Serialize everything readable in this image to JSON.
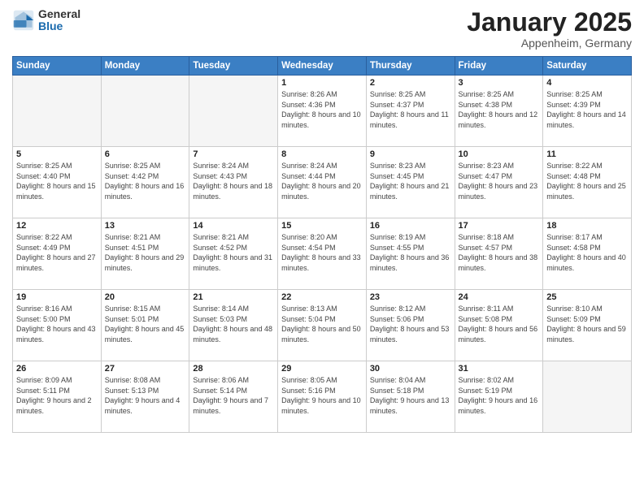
{
  "header": {
    "logo_general": "General",
    "logo_blue": "Blue",
    "month_title": "January 2025",
    "location": "Appenheim, Germany"
  },
  "days_of_week": [
    "Sunday",
    "Monday",
    "Tuesday",
    "Wednesday",
    "Thursday",
    "Friday",
    "Saturday"
  ],
  "weeks": [
    [
      {
        "day": "",
        "empty": true
      },
      {
        "day": "",
        "empty": true
      },
      {
        "day": "",
        "empty": true
      },
      {
        "day": "1",
        "sunrise": "8:26 AM",
        "sunset": "4:36 PM",
        "daylight": "8 hours and 10 minutes."
      },
      {
        "day": "2",
        "sunrise": "8:25 AM",
        "sunset": "4:37 PM",
        "daylight": "8 hours and 11 minutes."
      },
      {
        "day": "3",
        "sunrise": "8:25 AM",
        "sunset": "4:38 PM",
        "daylight": "8 hours and 12 minutes."
      },
      {
        "day": "4",
        "sunrise": "8:25 AM",
        "sunset": "4:39 PM",
        "daylight": "8 hours and 14 minutes."
      }
    ],
    [
      {
        "day": "5",
        "sunrise": "8:25 AM",
        "sunset": "4:40 PM",
        "daylight": "8 hours and 15 minutes."
      },
      {
        "day": "6",
        "sunrise": "8:25 AM",
        "sunset": "4:42 PM",
        "daylight": "8 hours and 16 minutes."
      },
      {
        "day": "7",
        "sunrise": "8:24 AM",
        "sunset": "4:43 PM",
        "daylight": "8 hours and 18 minutes."
      },
      {
        "day": "8",
        "sunrise": "8:24 AM",
        "sunset": "4:44 PM",
        "daylight": "8 hours and 20 minutes."
      },
      {
        "day": "9",
        "sunrise": "8:23 AM",
        "sunset": "4:45 PM",
        "daylight": "8 hours and 21 minutes."
      },
      {
        "day": "10",
        "sunrise": "8:23 AM",
        "sunset": "4:47 PM",
        "daylight": "8 hours and 23 minutes."
      },
      {
        "day": "11",
        "sunrise": "8:22 AM",
        "sunset": "4:48 PM",
        "daylight": "8 hours and 25 minutes."
      }
    ],
    [
      {
        "day": "12",
        "sunrise": "8:22 AM",
        "sunset": "4:49 PM",
        "daylight": "8 hours and 27 minutes."
      },
      {
        "day": "13",
        "sunrise": "8:21 AM",
        "sunset": "4:51 PM",
        "daylight": "8 hours and 29 minutes."
      },
      {
        "day": "14",
        "sunrise": "8:21 AM",
        "sunset": "4:52 PM",
        "daylight": "8 hours and 31 minutes."
      },
      {
        "day": "15",
        "sunrise": "8:20 AM",
        "sunset": "4:54 PM",
        "daylight": "8 hours and 33 minutes."
      },
      {
        "day": "16",
        "sunrise": "8:19 AM",
        "sunset": "4:55 PM",
        "daylight": "8 hours and 36 minutes."
      },
      {
        "day": "17",
        "sunrise": "8:18 AM",
        "sunset": "4:57 PM",
        "daylight": "8 hours and 38 minutes."
      },
      {
        "day": "18",
        "sunrise": "8:17 AM",
        "sunset": "4:58 PM",
        "daylight": "8 hours and 40 minutes."
      }
    ],
    [
      {
        "day": "19",
        "sunrise": "8:16 AM",
        "sunset": "5:00 PM",
        "daylight": "8 hours and 43 minutes."
      },
      {
        "day": "20",
        "sunrise": "8:15 AM",
        "sunset": "5:01 PM",
        "daylight": "8 hours and 45 minutes."
      },
      {
        "day": "21",
        "sunrise": "8:14 AM",
        "sunset": "5:03 PM",
        "daylight": "8 hours and 48 minutes."
      },
      {
        "day": "22",
        "sunrise": "8:13 AM",
        "sunset": "5:04 PM",
        "daylight": "8 hours and 50 minutes."
      },
      {
        "day": "23",
        "sunrise": "8:12 AM",
        "sunset": "5:06 PM",
        "daylight": "8 hours and 53 minutes."
      },
      {
        "day": "24",
        "sunrise": "8:11 AM",
        "sunset": "5:08 PM",
        "daylight": "8 hours and 56 minutes."
      },
      {
        "day": "25",
        "sunrise": "8:10 AM",
        "sunset": "5:09 PM",
        "daylight": "8 hours and 59 minutes."
      }
    ],
    [
      {
        "day": "26",
        "sunrise": "8:09 AM",
        "sunset": "5:11 PM",
        "daylight": "9 hours and 2 minutes."
      },
      {
        "day": "27",
        "sunrise": "8:08 AM",
        "sunset": "5:13 PM",
        "daylight": "9 hours and 4 minutes."
      },
      {
        "day": "28",
        "sunrise": "8:06 AM",
        "sunset": "5:14 PM",
        "daylight": "9 hours and 7 minutes."
      },
      {
        "day": "29",
        "sunrise": "8:05 AM",
        "sunset": "5:16 PM",
        "daylight": "9 hours and 10 minutes."
      },
      {
        "day": "30",
        "sunrise": "8:04 AM",
        "sunset": "5:18 PM",
        "daylight": "9 hours and 13 minutes."
      },
      {
        "day": "31",
        "sunrise": "8:02 AM",
        "sunset": "5:19 PM",
        "daylight": "9 hours and 16 minutes."
      },
      {
        "day": "",
        "empty": true
      }
    ]
  ],
  "labels": {
    "sunrise": "Sunrise:",
    "sunset": "Sunset:",
    "daylight": "Daylight:"
  }
}
